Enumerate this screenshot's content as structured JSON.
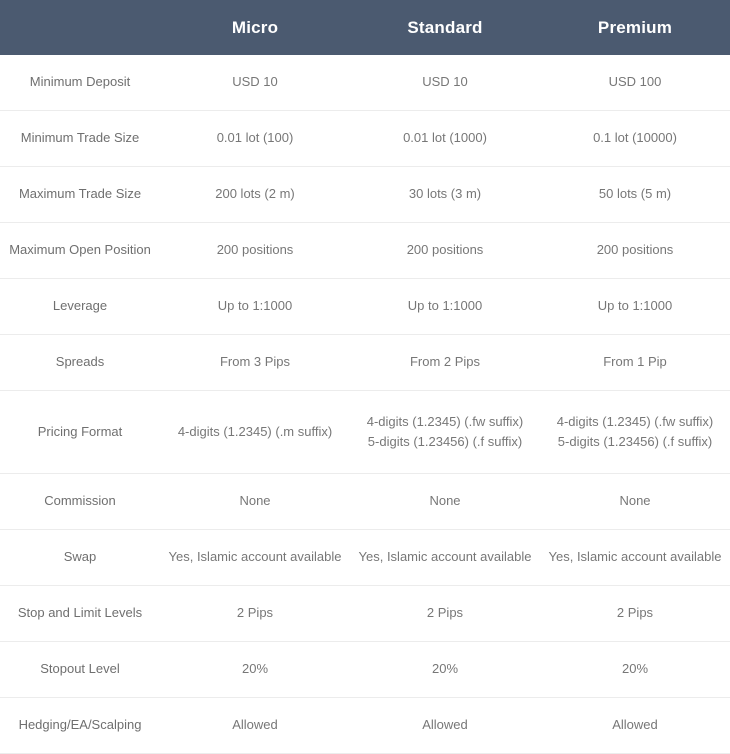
{
  "table": {
    "headers": [
      {
        "label": "",
        "name": "feature-column-header"
      },
      {
        "label": "Micro",
        "name": "plan-column-header-micro"
      },
      {
        "label": "Standard",
        "name": "plan-column-header-standard"
      },
      {
        "label": "Premium",
        "name": "plan-column-header-premium"
      }
    ],
    "header_bg": "#4b5a70",
    "header_text_color": "#ffffff",
    "body_text_color": "#777777",
    "divider_color": "#ececec",
    "rows": [
      {
        "feature": "Minimum Deposit",
        "micro": [
          "USD 10"
        ],
        "standard": [
          "USD 10"
        ],
        "premium": [
          "USD 100"
        ]
      },
      {
        "feature": "Minimum Trade Size",
        "micro": [
          "0.01 lot (100)"
        ],
        "standard": [
          "0.01 lot (1000)"
        ],
        "premium": [
          "0.1 lot (10000)"
        ]
      },
      {
        "feature": "Maximum Trade Size",
        "micro": [
          "200 lots (2 m)"
        ],
        "standard": [
          "30 lots (3 m)"
        ],
        "premium": [
          "50 lots (5 m)"
        ]
      },
      {
        "feature": "Maximum Open Position",
        "micro": [
          "200 positions"
        ],
        "standard": [
          "200 positions"
        ],
        "premium": [
          "200 positions"
        ]
      },
      {
        "feature": "Leverage",
        "micro": [
          "Up to 1:1000"
        ],
        "standard": [
          "Up to 1:1000"
        ],
        "premium": [
          "Up to 1:1000"
        ]
      },
      {
        "feature": "Spreads",
        "micro": [
          "From 3 Pips"
        ],
        "standard": [
          "From 2 Pips"
        ],
        "premium": [
          "From 1 Pip"
        ]
      },
      {
        "feature": "Pricing Format",
        "micro": [
          "4-digits (1.2345) (.m suffix)"
        ],
        "standard": [
          "4-digits (1.2345) (.fw suffix)",
          "5-digits (1.23456) (.f suffix)"
        ],
        "premium": [
          "4-digits (1.2345) (.fw suffix)",
          "5-digits (1.23456) (.f suffix)"
        ],
        "tall": true
      },
      {
        "feature": "Commission",
        "micro": [
          "None"
        ],
        "standard": [
          "None"
        ],
        "premium": [
          "None"
        ]
      },
      {
        "feature": "Swap",
        "micro": [
          "Yes, Islamic account available"
        ],
        "standard": [
          "Yes, Islamic account available"
        ],
        "premium": [
          "Yes, Islamic account available"
        ]
      },
      {
        "feature": "Stop and Limit Levels",
        "micro": [
          "2 Pips"
        ],
        "standard": [
          "2 Pips"
        ],
        "premium": [
          "2 Pips"
        ]
      },
      {
        "feature": "Stopout Level",
        "micro": [
          "20%"
        ],
        "standard": [
          "20%"
        ],
        "premium": [
          "20%"
        ]
      },
      {
        "feature": "Hedging/EA/Scalping",
        "micro": [
          "Allowed"
        ],
        "standard": [
          "Allowed"
        ],
        "premium": [
          "Allowed"
        ]
      }
    ]
  }
}
